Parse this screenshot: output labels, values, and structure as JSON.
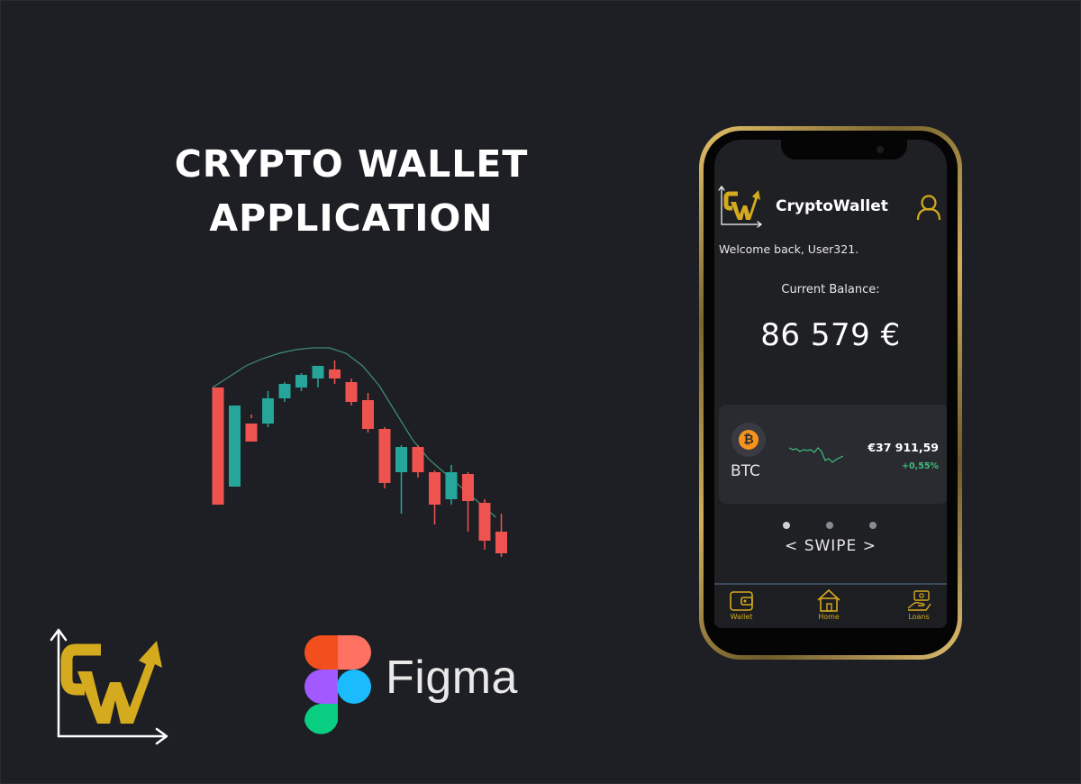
{
  "headline": {
    "line1": "CRYPTO WALLET",
    "line2": "APPLICATION"
  },
  "figma": {
    "wordmark": "Figma"
  },
  "phone": {
    "app_title": "CryptoWallet",
    "welcome": "Welcome back, User321.",
    "balance_label": "Current Balance:",
    "balance_value": "86 579 €",
    "coin": {
      "icon": "bitcoin-icon",
      "icon_glyph": "₿",
      "symbol": "BTC",
      "price": "€37 911,59",
      "change": "+0,55%"
    },
    "carousel": {
      "pages": 3,
      "active": 0
    },
    "swipe_hint": "<  SWIPE >",
    "nav": [
      {
        "label": "Wallet",
        "icon": "wallet-icon"
      },
      {
        "label": "Home",
        "icon": "home-icon"
      },
      {
        "label": "Loans",
        "icon": "loans-icon"
      }
    ]
  },
  "colors": {
    "background": "#1e1f24",
    "accent_gold": "#d4aa1e",
    "candle_up": "#26a69a",
    "candle_down": "#ef5350",
    "positive": "#3fbf7f",
    "bitcoin": "#f7931a"
  },
  "chart_data": {
    "type": "candlestick",
    "ohlc": [
      [
        8,
        8,
        1.5,
        1.5
      ],
      [
        2.5,
        7,
        7,
        2.5
      ],
      [
        6,
        6.3,
        5,
        6.5
      ],
      [
        6,
        7.8,
        7.4,
        5.8
      ],
      [
        7.4,
        8.3,
        8.2,
        7.2
      ],
      [
        8,
        8.8,
        8.7,
        7.8
      ],
      [
        8.5,
        9,
        9.2,
        8
      ],
      [
        9,
        9.5,
        8.5,
        8.2
      ],
      [
        8.3,
        8.5,
        7.2,
        7
      ],
      [
        7.3,
        7.7,
        5.7,
        5.5
      ],
      [
        5.7,
        5.8,
        2.7,
        2.4
      ],
      [
        3.3,
        4.8,
        4.7,
        1
      ],
      [
        4.7,
        4.8,
        3.3,
        3
      ],
      [
        3.3,
        3.4,
        1.5,
        0.4
      ],
      [
        1.8,
        3.7,
        3.3,
        1.5
      ],
      [
        3.2,
        3.3,
        1.7,
        0
      ],
      [
        1.6,
        1.8,
        -0.5,
        -1
      ],
      [
        0,
        1,
        -1.2,
        -1.4
      ]
    ],
    "moving_average": [
      8,
      8.6,
      9.2,
      9.6,
      9.9,
      10.1,
      10.2,
      10.2,
      9.9,
      9.2,
      8.1,
      6.6,
      5.1,
      4,
      3.2,
      2.4,
      1.6,
      0.8
    ]
  }
}
